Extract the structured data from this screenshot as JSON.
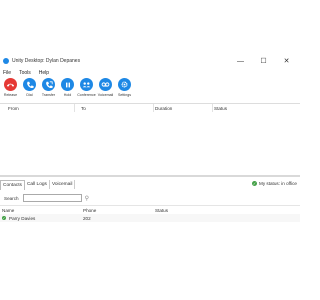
{
  "window": {
    "title": "Unity Desktop: Dylan Depanes"
  },
  "menu": [
    "File",
    "Tools",
    "Help"
  ],
  "toolbar": [
    {
      "label": "Release",
      "icon": "release-icon",
      "color": "#e53935"
    },
    {
      "label": "Dial",
      "icon": "dial-icon",
      "color": "#1e88e5"
    },
    {
      "label": "Transfer",
      "icon": "transfer-icon",
      "color": "#1e88e5"
    },
    {
      "label": "Hold",
      "icon": "hold-icon",
      "color": "#1e88e5"
    },
    {
      "label": "Conference",
      "icon": "conference-icon",
      "color": "#1e88e5"
    },
    {
      "label": "Voicemail",
      "icon": "voicemail-icon",
      "color": "#1e88e5"
    },
    {
      "label": "Settings",
      "icon": "settings-icon",
      "color": "#1e88e5"
    }
  ],
  "calls_table": {
    "columns": [
      "From",
      "To",
      "Duration",
      "Status"
    ]
  },
  "tabs": [
    "Contacts",
    "Call Logs",
    "Voicemail"
  ],
  "active_tab": "Contacts",
  "my_status": "My status: in office",
  "search": {
    "label": "Search",
    "placeholder": ""
  },
  "contacts": {
    "columns": [
      "Name",
      "Phone",
      "Status"
    ],
    "rows": [
      {
        "name": "Parry Davies",
        "phone": "202",
        "status": ""
      }
    ]
  },
  "colors": {
    "accent": "#1e88e5",
    "danger": "#e53935",
    "available": "#43a047"
  }
}
